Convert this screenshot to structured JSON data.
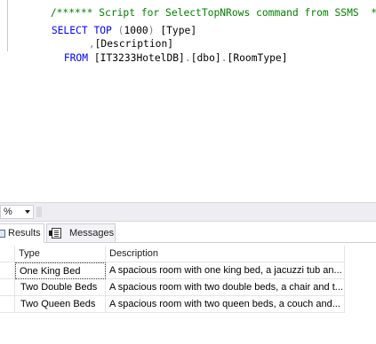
{
  "editor": {
    "comment": "/****** Script for SelectTopNRows command from SSMS  ******/",
    "line1": {
      "select_kw": "SELECT",
      "top_kw": "TOP",
      "paren_open": "(",
      "number": "1000",
      "paren_close": ")",
      "column": "[Type]"
    },
    "line2": {
      "comma": ",",
      "column": "[Description]"
    },
    "line3": {
      "from_kw": "FROM",
      "table": "[IT3233HotelDB]",
      "dot1": ".",
      "schema": "[dbo]",
      "dot2": ".",
      "object": "[RoomType]"
    }
  },
  "zoom": {
    "value": "%"
  },
  "tabs": {
    "results": "Results",
    "messages": "Messages"
  },
  "grid": {
    "columns": [
      "Type",
      "Description"
    ],
    "rows": [
      {
        "type": "One King Bed",
        "description": "A spacious room with one king bed, a jacuzzi tub an..."
      },
      {
        "type": "Two Double Beds",
        "description": "A spacious room with two double beds, a chair and t..."
      },
      {
        "type": "Two Queen Beds",
        "description": "A spacious room with two queen beds, a couch and..."
      }
    ]
  },
  "colors": {
    "keyword": "#0000ff",
    "comment": "#008000",
    "operator": "#808080"
  }
}
